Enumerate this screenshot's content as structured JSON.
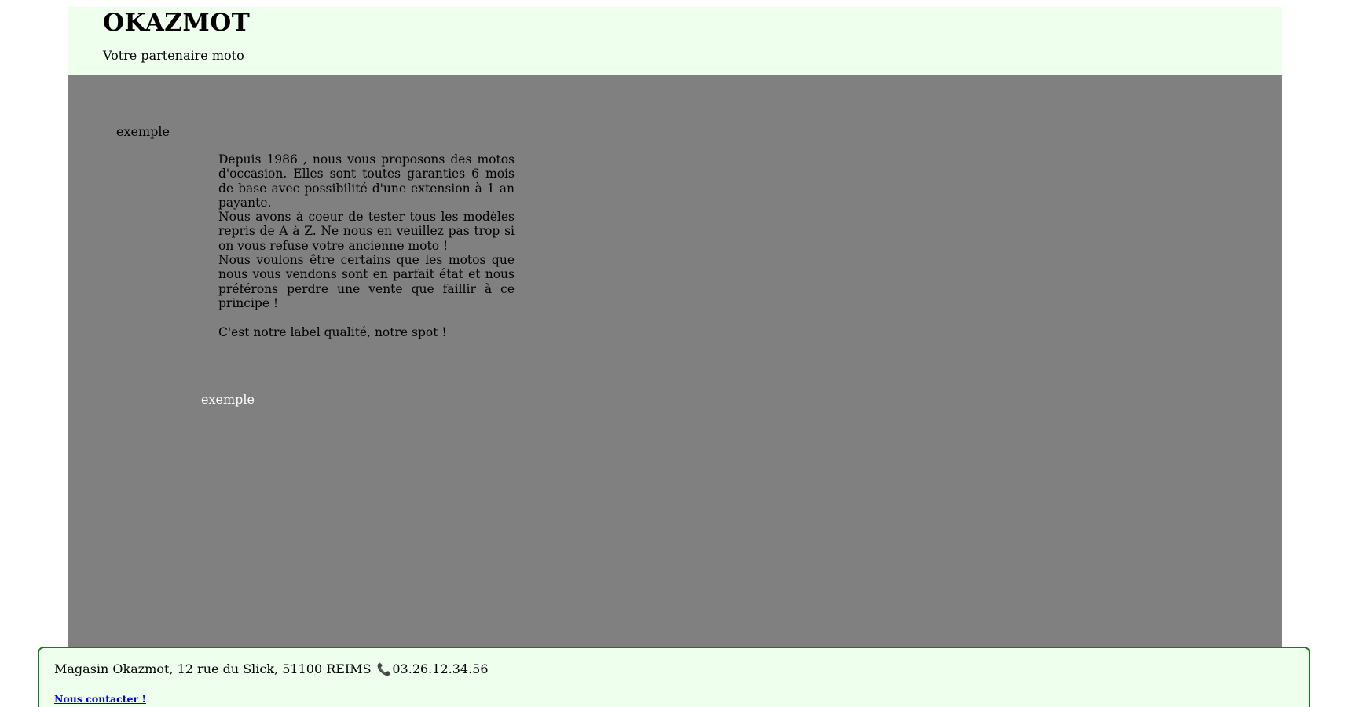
{
  "header": {
    "title": "OKAZMOT",
    "tagline": "Votre partenaire moto"
  },
  "main": {
    "image_alt": "exemple",
    "intro": {
      "line1": "Depuis 1986 , nous vous proposons des motos d'occasion. Elles sont toutes garanties 6 mois de base avec possibilité d'une extension à 1 an payante.",
      "line2": "Nous avons à coeur de tester tous les modèles repris de A à Z. Ne nous en veuillez pas trop si on vous refuse votre ancienne moto !",
      "line3": "Nous voulons être certains que les motos que nous vous vendons sont en parfait état et nous préférons perdre une vente que faillir à ce principe !",
      "line4": "C'est notre label qualité, notre spot !"
    },
    "example_link": "exemple"
  },
  "footer": {
    "address": "Magasin Okazmot, 12 rue du Slick, 51100 REIMS",
    "phone_icon": "phone-icon",
    "phone": "03.26.12.34.56",
    "contact_link": "Nous contacter !"
  },
  "colors": {
    "header_bg": "#eeffee",
    "main_bg": "#808080",
    "footer_border": "#1a7a1a",
    "link": "#0000ee"
  }
}
